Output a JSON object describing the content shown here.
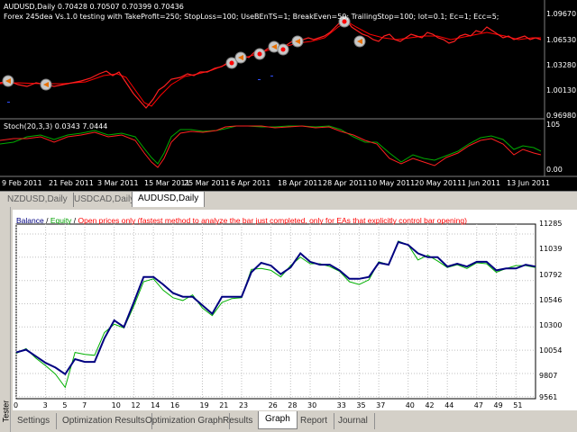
{
  "price_chart": {
    "symbol_line": "AUDUSD,Daily  0.70428 0.70507 0.70399 0.70436",
    "ea_line": "Forex 245dea Vs.1.0 testing with TakeProfit=250; StopLoss=100; UseBEnTS=1; BreakEven=50; TrailingStop=100; lot=0.1; Ec=1; Ecc=5;",
    "price_labels": [
      "1.09670",
      "1.06530",
      "1.03280",
      "1.00130",
      "0.96980"
    ],
    "stoch_label": "Stoch(20,3,3) 0.0343 7.0444",
    "stoch_levels": [
      "105",
      "0.00"
    ],
    "dates": [
      "9 Feb 2011",
      "21 Feb 2011",
      "3 Mar 2011",
      "15 Mar 2011",
      "25 Mar 2011",
      "6 Apr 2011",
      "18 Apr 2011",
      "28 Apr 2011",
      "10 May 2011",
      "20 May 2011",
      "1 Jun 2011",
      "13 Jun 2011"
    ],
    "colors": {
      "background": "#000000",
      "price_line": "#ff0000",
      "stoch_main": "#ff0000",
      "stoch_signal": "#00aa00"
    }
  },
  "chart_tabs": [
    "NZDUSD,Daily",
    "USDCAD,Daily",
    "AUDUSD,Daily"
  ],
  "active_chart_tab": "AUDUSD,Daily",
  "tester": {
    "side_label": "Tester",
    "legend": {
      "balance": "Balance",
      "sep1": " / ",
      "equity": "Equity",
      "sep2": " / ",
      "note": "Open prices only (fastest method to analyze the bar just completed, only for EAs that explicitly control bar opening)"
    },
    "colors": {
      "balance": "#000080",
      "equity": "#00b000",
      "note": "#ff0000"
    },
    "tabs": [
      "Settings",
      "Optimization Results",
      "Optimization Graph",
      "Results",
      "Graph",
      "Report",
      "Journal"
    ],
    "active_tab": "Graph"
  },
  "chart_data": {
    "type": "line",
    "title": "",
    "xlabel": "",
    "ylabel": "",
    "ylim": [
      9540,
      11390
    ],
    "y_ticks": [
      "11285",
      "11039",
      "10792",
      "10546",
      "10300",
      "10054",
      "9807",
      "9561"
    ],
    "x_ticks": [
      "0",
      "3",
      "5",
      "7",
      "10",
      "12",
      "14",
      "16",
      "19",
      "21",
      "23",
      "26",
      "28",
      "30",
      "33",
      "35",
      "37",
      "40",
      "42",
      "44",
      "47",
      "49",
      "51"
    ],
    "grid": true,
    "series": [
      {
        "name": "Balance",
        "x": [
          0,
          1,
          2,
          3,
          4,
          5,
          6,
          7,
          8,
          9,
          10,
          11,
          12,
          13,
          14,
          15,
          16,
          17,
          18,
          19,
          20,
          21,
          22,
          23,
          24,
          25,
          26,
          27,
          28,
          29,
          30,
          31,
          32,
          33,
          34,
          35,
          36,
          37,
          38,
          39,
          40,
          41,
          42,
          43,
          44,
          45,
          46,
          47,
          48,
          49,
          50,
          51,
          52,
          53
        ],
        "values": [
          10030,
          10060,
          9990,
          9920,
          9870,
          9800,
          9960,
          9930,
          9930,
          10180,
          10370,
          10300,
          10560,
          10830,
          10830,
          10750,
          10660,
          10620,
          10620,
          10530,
          10440,
          10620,
          10620,
          10620,
          10880,
          10980,
          10950,
          10860,
          10930,
          11080,
          10990,
          10960,
          10960,
          10900,
          10810,
          10810,
          10830,
          10980,
          10960,
          11200,
          11170,
          11080,
          11040,
          11040,
          10940,
          10970,
          10940,
          10990,
          10990,
          10900,
          10920,
          10920,
          10960,
          10940
        ]
      },
      {
        "name": "Equity",
        "x": [
          0,
          1,
          2,
          3,
          4,
          5,
          6,
          7,
          8,
          9,
          10,
          11,
          12,
          13,
          14,
          15,
          16,
          17,
          18,
          19,
          20,
          21,
          22,
          23,
          24,
          25,
          26,
          27,
          28,
          29,
          30,
          31,
          32,
          33,
          34,
          35,
          36,
          37,
          38,
          39,
          40,
          41,
          42,
          43,
          44,
          45,
          46,
          47,
          48,
          49,
          50,
          51,
          52,
          53
        ],
        "values": [
          10020,
          10070,
          9970,
          9890,
          9800,
          9660,
          10030,
          10010,
          10000,
          10240,
          10330,
          10290,
          10520,
          10780,
          10810,
          10690,
          10610,
          10580,
          10640,
          10500,
          10420,
          10560,
          10600,
          10610,
          10910,
          10920,
          10900,
          10830,
          10950,
          11040,
          10970,
          10970,
          10940,
          10890,
          10780,
          10750,
          10800,
          10990,
          10960,
          11210,
          11170,
          11010,
          11060,
          11000,
          10930,
          10960,
          10920,
          10980,
          10970,
          10880,
          10920,
          10950,
          10950,
          10930
        ]
      }
    ]
  }
}
